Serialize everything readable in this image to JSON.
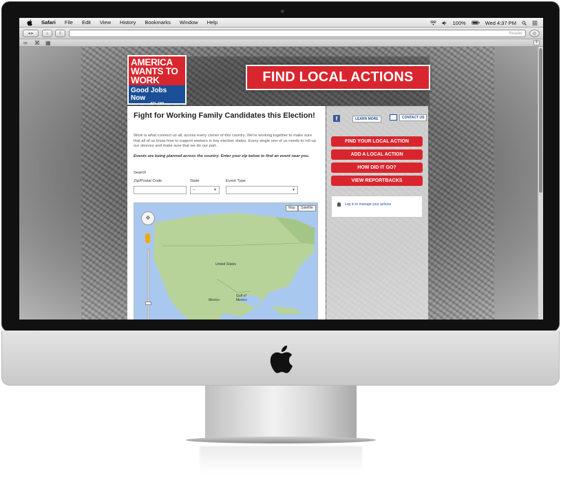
{
  "menubar": {
    "app": "Safari",
    "items": [
      "File",
      "Edit",
      "View",
      "History",
      "Bookmarks",
      "Window",
      "Help"
    ],
    "battery": "100%",
    "clock": "Wed 4:37 PM"
  },
  "toolbar": {
    "reader_label": "Reader"
  },
  "site": {
    "logo": {
      "line1": "AMERICA WANTS TO WORK",
      "line2": "Good Jobs Now",
      "line3": "AFL-CIO"
    },
    "banner": "FIND LOCAL ACTIONS",
    "heading": "Fight for Working Family Candidates this Election!",
    "intro": "Work is what connect us all, across every corner of this country. We're working together to make sure that all of us know how to support workers in key election states. Every single one of us needs to roll up our sleeves and make sure that we do our part.",
    "events_note": "Events are being planned across the country. Enter your zip below to find an event near you.",
    "search": {
      "title": "Search",
      "zip_label": "Zip/Postal Code",
      "state_label": "State",
      "state_value": "--",
      "event_type_label": "Event Type",
      "event_type_value": ""
    },
    "map": {
      "map_button": "Map",
      "satellite_button": "Satellite",
      "labels": [
        "United States",
        "Mexico",
        "Gulf of Mexico"
      ]
    },
    "sidebar": {
      "learn_more": "LEARN MORE",
      "contact_us": "CONTACT US",
      "buttons": [
        "FIND YOUR LOCAL ACTION",
        "ADD A LOCAL ACTION",
        "HOW DID IT GO?",
        "VIEW REPORTBACKS"
      ],
      "login_text": "Log in to manage your actions"
    }
  },
  "colors": {
    "brand_red": "#d9262e",
    "brand_blue": "#1b4f97",
    "map_water": "#a8c8f0",
    "map_land": "#b7d39a"
  }
}
